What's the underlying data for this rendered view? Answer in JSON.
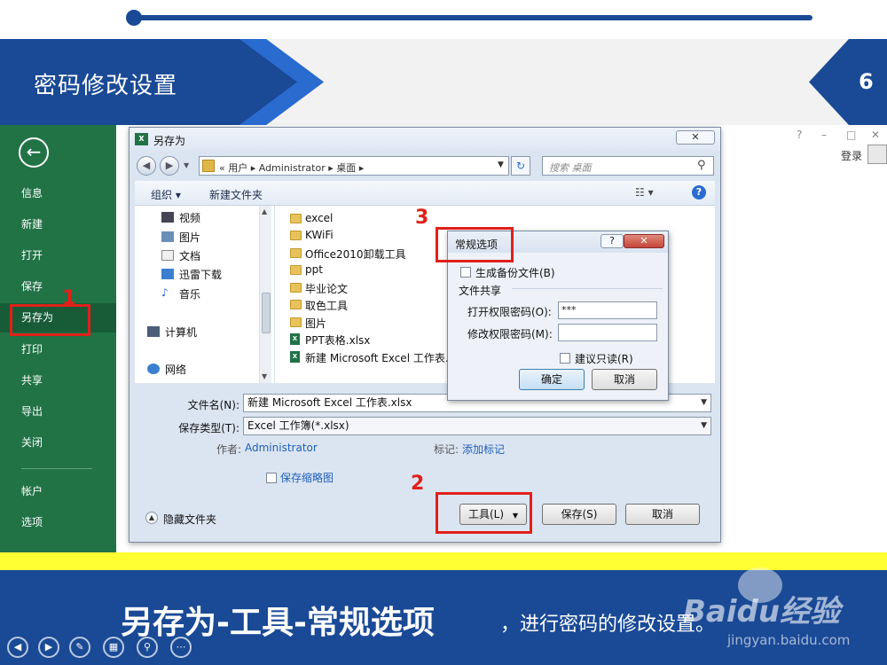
{
  "slide": {
    "title": "密码修改设置",
    "page_number": "6",
    "colors": {
      "primary": "#1a4a96",
      "accent": "#2a6bd0",
      "excel_green": "#217346",
      "highlight": "#ffff33",
      "annotation_red": "#e0201a"
    }
  },
  "backstage": {
    "back_icon": "arrow-left-icon",
    "menu": [
      "信息",
      "新建",
      "打开",
      "保存",
      "另存为",
      "打印",
      "共享",
      "导出",
      "关闭",
      "帐户",
      "选项"
    ],
    "active_item": "另存为",
    "window_controls": [
      "?",
      "–",
      "□",
      "✕"
    ],
    "login_label": "登录"
  },
  "save_dialog": {
    "title": "另存为",
    "address_path": "« 用户 ▸ Administrator ▸ 桌面 ▸",
    "search_placeholder": "搜索 桌面",
    "toolbar": {
      "organize": "组织 ▾",
      "new_folder": "新建文件夹"
    },
    "nav_items": [
      "视频",
      "图片",
      "文档",
      "迅雷下载",
      "音乐",
      "计算机",
      "网络"
    ],
    "files": [
      {
        "name": "excel",
        "type": "folder"
      },
      {
        "name": "KWiFi",
        "type": "folder"
      },
      {
        "name": "Office2010卸载工具",
        "type": "folder"
      },
      {
        "name": "ppt",
        "type": "folder"
      },
      {
        "name": "毕业论文",
        "type": "folder"
      },
      {
        "name": "取色工具",
        "type": "folder"
      },
      {
        "name": "图片",
        "type": "folder"
      },
      {
        "name": "PPT表格.xlsx",
        "type": "xlsx"
      },
      {
        "name": "新建 Microsoft Excel 工作表.x",
        "type": "xlsx"
      }
    ],
    "filename_label": "文件名(N):",
    "filename_value": "新建 Microsoft Excel 工作表.xlsx",
    "filetype_label": "保存类型(T):",
    "filetype_value": "Excel 工作簿(*.xlsx)",
    "author_label": "作者:",
    "author_value": "Administrator",
    "tags_label": "标记:",
    "tags_value": "添加标记",
    "thumbnail_label": "保存缩略图",
    "hide_folders_label": "隐藏文件夹",
    "tools_button": "工具(L)",
    "save_button": "保存(S)",
    "cancel_button": "取消"
  },
  "options_dialog": {
    "title": "常规选项",
    "backup_label": "生成备份文件(B)",
    "file_sharing_label": "文件共享",
    "open_password_label": "打开权限密码(O):",
    "open_password_value": "***",
    "modify_password_label": "修改权限密码(M):",
    "modify_password_value": "",
    "readonly_label": "建议只读(R)",
    "ok_button": "确定",
    "cancel_button": "取消"
  },
  "annotations": {
    "step1": "1",
    "step2": "2",
    "step3": "3"
  },
  "caption": {
    "main": "另存为-工具-常规选项",
    "sub": "，进行密码的修改设置。"
  },
  "watermark": {
    "logo": "Baidu经验",
    "url": "jingyan.baidu.com"
  }
}
